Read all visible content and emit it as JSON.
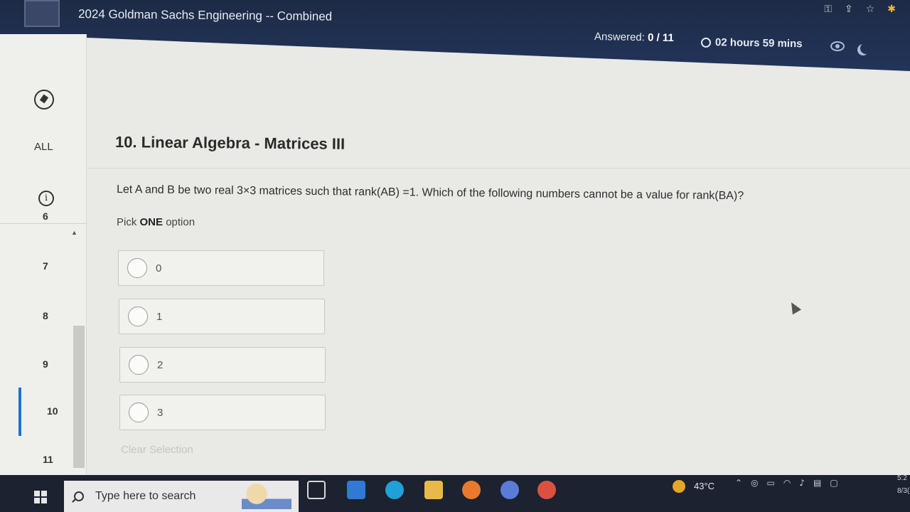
{
  "header": {
    "title": "2024 Goldman Sachs Engineering -- Combined",
    "answered_label": "Answered:",
    "answered_value": "0 / 11",
    "timer": "02 hours 59 mins"
  },
  "sidebar": {
    "all_label": "ALL",
    "questions": [
      "6",
      "7",
      "8",
      "9",
      "10",
      "11"
    ],
    "active": "10"
  },
  "question": {
    "title": "10. Linear Algebra - Matrices III",
    "text": "Let A and B be two real 3×3 matrices such that rank(AB) =1. Which of the following numbers cannot be a value for rank(BA)?",
    "pick_prefix": "Pick",
    "pick_bold": "ONE",
    "pick_suffix": "option",
    "options": [
      "0",
      "1",
      "2",
      "3"
    ],
    "clear_label": "Clear Selection"
  },
  "taskbar": {
    "search_placeholder": "Type here to search",
    "temperature": "43°C",
    "clock_time": "5:2",
    "clock_date": "8/3("
  },
  "colors": {
    "header_bg": "#1d2b45",
    "active_accent": "#1a73d6",
    "taskbar_bg": "#1c2230"
  }
}
